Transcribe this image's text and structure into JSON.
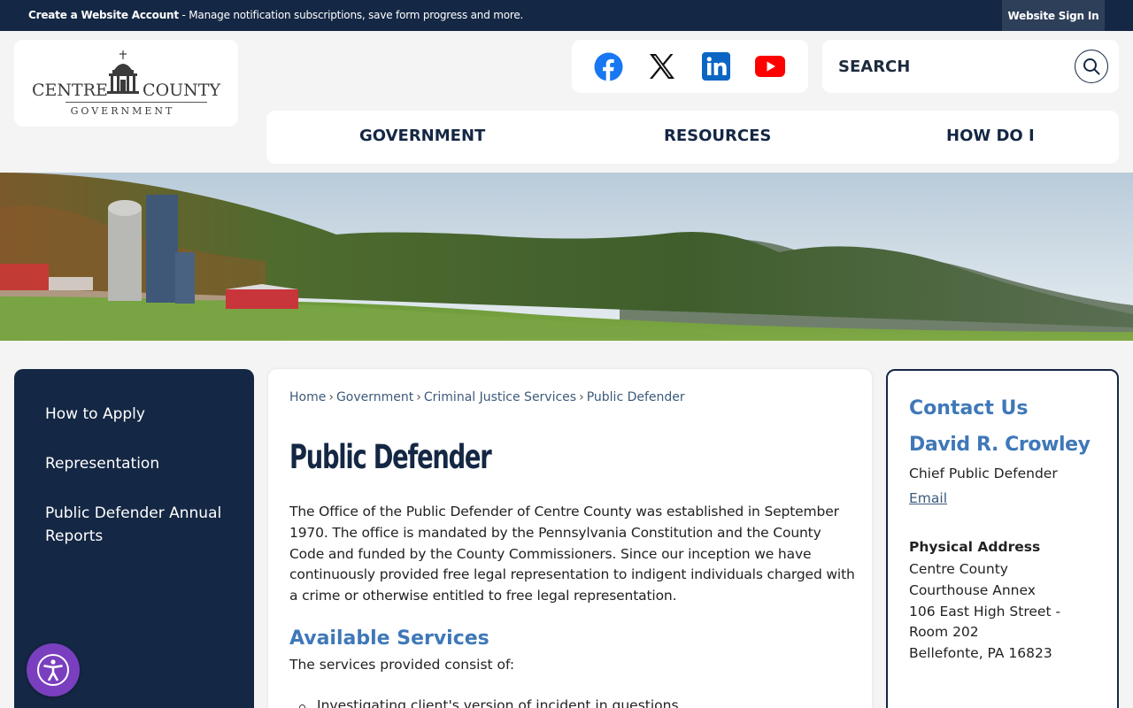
{
  "topbar": {
    "create_bold": "Create a Website Account",
    "create_rest": " - Manage notification subscriptions, save form progress and more.",
    "signin_label": "Website Sign In"
  },
  "logo": {
    "word_left": "CENTRE",
    "word_right": "COUNTY",
    "word_bottom": "GOVERNMENT"
  },
  "social": [
    "facebook-icon",
    "x-icon",
    "linkedin-icon",
    "youtube-icon"
  ],
  "search": {
    "placeholder": "SEARCH"
  },
  "nav": {
    "items": [
      {
        "label": "GOVERNMENT"
      },
      {
        "label": "RESOURCES"
      },
      {
        "label": "HOW DO I"
      }
    ]
  },
  "sidebar": {
    "items": [
      {
        "label": "How to Apply"
      },
      {
        "label": "Representation"
      },
      {
        "label": "Public Defender Annual Reports"
      }
    ]
  },
  "breadcrumb": {
    "items": [
      {
        "label": "Home"
      },
      {
        "label": "Government"
      },
      {
        "label": "Criminal Justice Services"
      }
    ],
    "current": "Public Defender",
    "separator": "›"
  },
  "main": {
    "title": "Public Defender",
    "intro": "The Office of the Public Defender of Centre County was established in September 1970. The office is mandated by the Pennsylvania Constitution and the County Code and funded by the County Commissioners. Since our inception we have continuously provided free legal representation to indigent individuals charged with a crime or otherwise entitled to free legal representation.",
    "services_heading": "Available Services",
    "services_intro": "The services provided consist of:",
    "services": [
      "Investigating client's version of incident in questions"
    ]
  },
  "contact": {
    "heading": "Contact Us",
    "name": "David R. Crowley",
    "role": "Chief Public Defender",
    "email_label": "Email",
    "address_heading": "Physical Address",
    "address_lines": [
      "Centre County",
      "Courthouse Annex",
      "106 East High Street -",
      "Room 202",
      "Bellefonte, PA 16823"
    ]
  },
  "colors": {
    "navy": "#142744",
    "accent_blue": "#3f78b8",
    "accessibility_purple": "#7a3fbf"
  }
}
